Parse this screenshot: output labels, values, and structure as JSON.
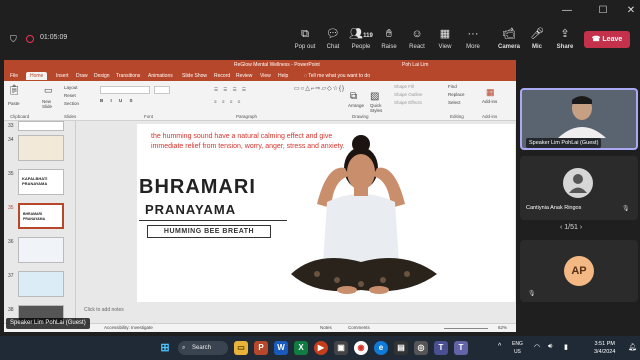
{
  "meeting": {
    "timer": "01:05:09",
    "buttons": [
      {
        "icon": "popout-icon",
        "label": "Pop out"
      },
      {
        "icon": "chat-icon",
        "label": "Chat"
      },
      {
        "icon": "people-icon",
        "label": "People",
        "count": "119"
      },
      {
        "icon": "raise-hand-icon",
        "label": "Raise"
      },
      {
        "icon": "react-icon",
        "label": "React"
      },
      {
        "icon": "view-icon",
        "label": "View"
      },
      {
        "icon": "more-icon",
        "label": "More"
      },
      {
        "icon": "camera-icon",
        "label": "Camera"
      },
      {
        "icon": "mic-icon",
        "label": "Mic"
      },
      {
        "icon": "share-icon",
        "label": "Share"
      }
    ],
    "leave_label": "Leave"
  },
  "ppt": {
    "title": "ReGlow Mental Wellness - PowerPoint",
    "user": "Poh Lai Lim",
    "tell_me": "Tell me what you want to do",
    "tabs": [
      "File",
      "Home",
      "Insert",
      "Draw",
      "Design",
      "Transitions",
      "Animations",
      "Slide Show",
      "Record",
      "Review",
      "View",
      "Help"
    ],
    "active_tab": "Home",
    "ribbon_groups": [
      "Clipboard",
      "Slides",
      "Font",
      "Paragraph",
      "Drawing",
      "Editing",
      "Add-ins"
    ],
    "ribbon_items": {
      "paste": "Paste",
      "new_slide": "New Slide",
      "layout": "Layout",
      "reset": "Reset",
      "section": "Section",
      "arrange": "Arrange",
      "quick_styles": "Quick Styles",
      "shape_fill": "Shape Fill",
      "shape_outline": "Shape Outline",
      "shape_effects": "Shape Effects",
      "find": "Find",
      "replace": "Replace",
      "select": "Select",
      "add_ins": "Add-ins"
    },
    "thumbnails": [
      {
        "num": "33",
        "title": ""
      },
      {
        "num": "34",
        "title": ""
      },
      {
        "num": "35",
        "title": "KAPALBHATI PRANAYAMA"
      },
      {
        "num": "35",
        "title": "BHRAMARI PRANAYAMA"
      },
      {
        "num": "36",
        "title": ""
      },
      {
        "num": "37",
        "title": ""
      },
      {
        "num": "38",
        "title": ""
      }
    ],
    "notes_placeholder": "Click to add notes",
    "status": {
      "accessibility": "Accessibility: Investigate",
      "notes": "Notes",
      "comments": "Comments",
      "zoom": "62%"
    }
  },
  "slide": {
    "tagline": "the humming sound have a natural calming effect and give immediate relief from tension, worry, anger, stress and anxiety.",
    "title_line1": "BHRAMARI",
    "title_line2": "PRANAYAMA",
    "subtitle": "HUMMING BEE BREATH"
  },
  "participants": {
    "speaker_label": "Speaker Lim PohLai (Guest)",
    "second_name": "Cantiynia Anak Ringos",
    "pager": "1/51",
    "third_initials": "AP",
    "bottom_overlay": "Speaker Lim PohLai (Guest)"
  },
  "taskbar": {
    "search": "Search",
    "lang_top": "ENG",
    "lang_bottom": "US",
    "time": "3:51 PM",
    "date": "3/4/2024"
  },
  "colors": {
    "ppt_accent": "#b7472a",
    "leave_red": "#c4314b",
    "tagline_red": "#d6332c",
    "tile_border": "#a9a9f4"
  }
}
